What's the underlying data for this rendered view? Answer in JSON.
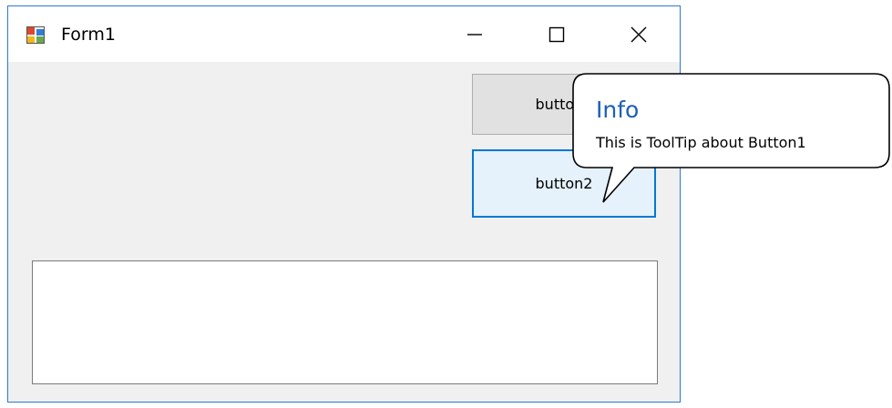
{
  "window": {
    "title": "Form1",
    "icon": "winforms-app-icon",
    "caption_buttons": [
      "minimize-icon",
      "maximize-icon",
      "close-icon"
    ]
  },
  "form": {
    "button1_label": "button1",
    "button2_label": "button2",
    "textbox_value": ""
  },
  "tooltip": {
    "title": "Info",
    "text": "This is ToolTip about Button1"
  },
  "colors": {
    "accent": "#0078d7",
    "window_border": "#2b79d7",
    "tooltip_title": "#1c5fb8",
    "form_background": "#f0f0f0"
  }
}
